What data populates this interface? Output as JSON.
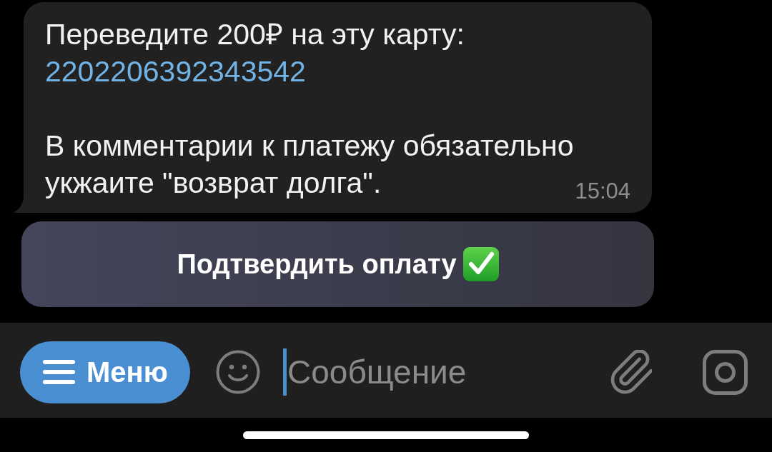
{
  "message": {
    "text": "Переведите 200₽ на эту карту:",
    "card_number": "2202206392343542",
    "note": "В комментарии к платежу обязательно укжаите \"возврат долга\".",
    "time": "15:04"
  },
  "inline_button": {
    "label": "Подтвердить оплату"
  },
  "composer": {
    "menu_button": "Меню",
    "placeholder": "Сообщение",
    "focused": true
  }
}
